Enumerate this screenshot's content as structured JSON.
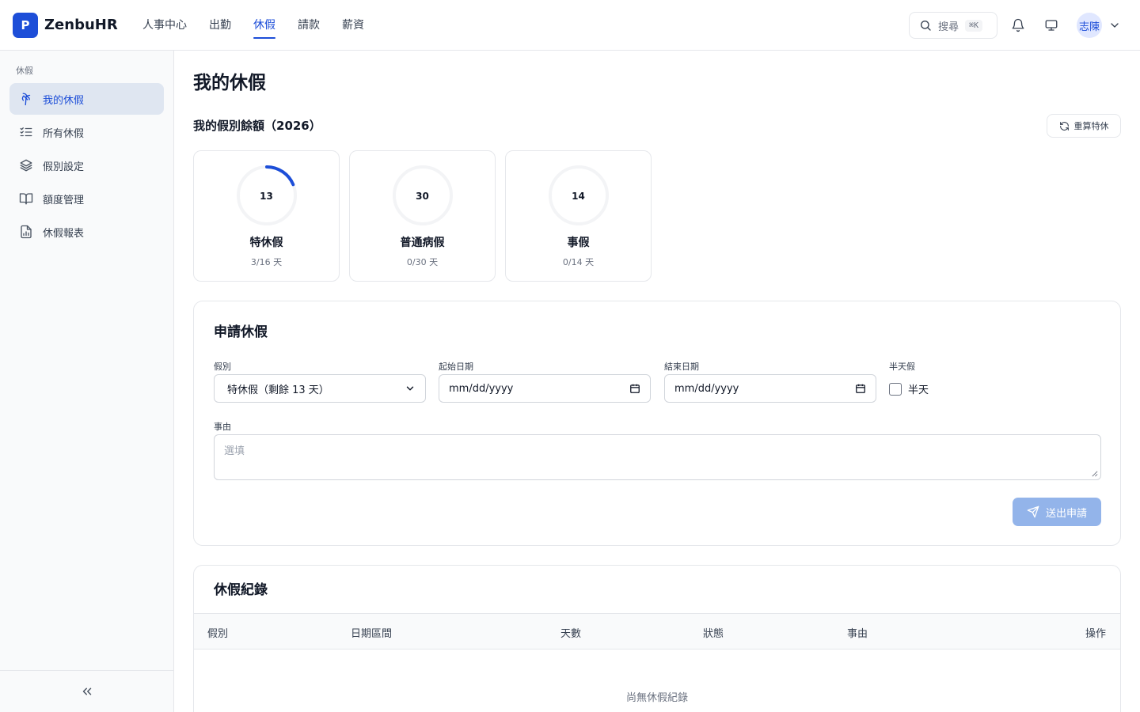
{
  "brand": {
    "logo_letter": "P",
    "name": "ZenbuHR"
  },
  "top_nav": {
    "items": [
      "人事中心",
      "出勤",
      "休假",
      "請款",
      "薪資"
    ],
    "active": "休假"
  },
  "header": {
    "search_label": "搜尋",
    "search_shortcut": "⌘K",
    "user_name": "志陳"
  },
  "sidebar": {
    "section": "休假",
    "items": [
      "我的休假",
      "所有休假",
      "假別設定",
      "額度管理",
      "休假報表"
    ],
    "active": "我的休假"
  },
  "page": {
    "title": "我的休假",
    "balance_title": "我的假別餘額（2026）",
    "recalc_label": "重算特休"
  },
  "balances": [
    {
      "remaining": "13",
      "name": "特休假",
      "usage": "3/16 天",
      "used_fraction": 0.1875
    },
    {
      "remaining": "30",
      "name": "普通病假",
      "usage": "0/30 天",
      "used_fraction": 0
    },
    {
      "remaining": "14",
      "name": "事假",
      "usage": "0/14 天",
      "used_fraction": 0
    }
  ],
  "apply_form": {
    "title": "申請休假",
    "type_label": "假別",
    "type_value": "特休假（剩餘 13 天）",
    "start_label": "起始日期",
    "start_value": "mm/dd/yyyy",
    "end_label": "結束日期",
    "end_value": "mm/dd/yyyy",
    "half_day_label": "半天假",
    "half_day_option": "半天",
    "reason_label": "事由",
    "reason_placeholder": "選填",
    "submit_label": "送出申請"
  },
  "records": {
    "title": "休假紀錄",
    "columns": [
      "假別",
      "日期區間",
      "天數",
      "狀態",
      "事由",
      "操作"
    ],
    "empty_text": "尚無休假紀錄"
  },
  "colors": {
    "accent": "#1d4ed8",
    "submit_disabled": "#93b4ea"
  }
}
